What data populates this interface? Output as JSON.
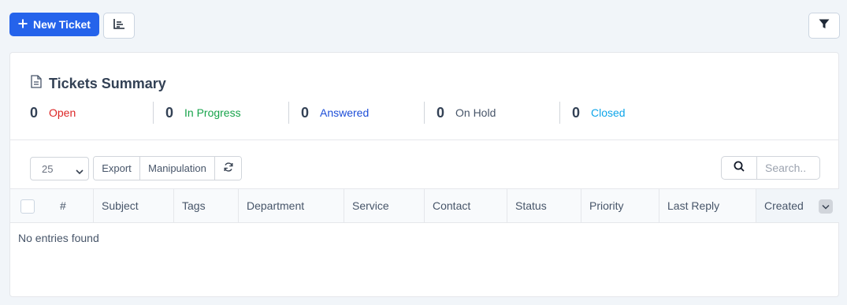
{
  "toolbar": {
    "new_ticket_label": "New Ticket",
    "new_ticket_icon": "plus-icon",
    "chart_icon": "bar-chart-icon",
    "filter_icon": "filter-icon",
    "accent": "#2563eb"
  },
  "summary": {
    "title": "Tickets Summary",
    "title_icon": "document-icon",
    "stats": [
      {
        "count": "0",
        "label": "Open",
        "color": "#dc2626"
      },
      {
        "count": "0",
        "label": "In Progress",
        "color": "#16a34a"
      },
      {
        "count": "0",
        "label": "Answered",
        "color": "#1d4ed8"
      },
      {
        "count": "0",
        "label": "On Hold",
        "color": "#475569"
      },
      {
        "count": "0",
        "label": "Closed",
        "color": "#0ea5e9"
      }
    ]
  },
  "controls": {
    "page_length": "25",
    "export_label": "Export",
    "manipulation_label": "Manipulation",
    "refresh_icon": "refresh-icon",
    "search_placeholder": "Search.."
  },
  "table": {
    "columns": [
      "#",
      "Subject",
      "Tags",
      "Department",
      "Service",
      "Contact",
      "Status",
      "Priority",
      "Last Reply",
      "Created"
    ],
    "empty_text": "No entries found"
  }
}
